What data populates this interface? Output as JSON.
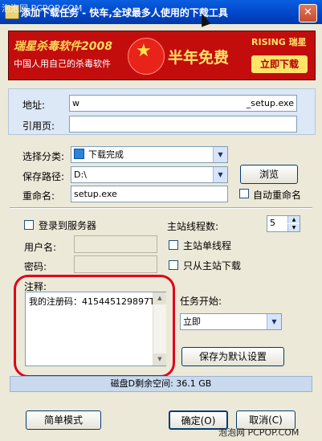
{
  "watermark": {
    "top_left": "泡泡网 PCPOP.COM",
    "bottom_right": "泡泡网 PCPOP.COM"
  },
  "window": {
    "title": "添加下载任务 - 快车,全球最多人使用的下载工具",
    "close_label": "✕"
  },
  "banner": {
    "logo": "瑞星杀毒软件2008",
    "slogan": "中国人用自己的杀毒软件",
    "offer": "半年免费",
    "brand": "RISING 瑞星",
    "download": "立即下载"
  },
  "form": {
    "address_label": "地址:",
    "address_value": "_setup.exe",
    "address_prefix": "w",
    "referer_label": "引用页:",
    "referer_value": "",
    "category_label": "选择分类:",
    "category_value": "下载完成",
    "savepath_label": "保存路径:",
    "savepath_value": "D:\\",
    "browse_label": "浏览",
    "rename_label": "重命名:",
    "rename_value": "setup.exe",
    "auto_rename_label": "自动重命名",
    "login_label": "登录到服务器",
    "username_label": "用户名:",
    "password_label": "密码:",
    "threads_label": "主站线程数:",
    "threads_value": "5",
    "single_thread_label": "主站单线程",
    "only_main_label": "只从主站下载",
    "comment_label": "注释:",
    "comment_value": "我的注册码：415445129897T",
    "start_label": "任务开始:",
    "start_value": "立即",
    "save_default_label": "保存为默认设置",
    "disk_space": "磁盘D剩余空间: 36.1 GB"
  },
  "buttons": {
    "simple_mode": "简单模式",
    "ok": "确定(O)",
    "cancel": "取消(C)"
  }
}
